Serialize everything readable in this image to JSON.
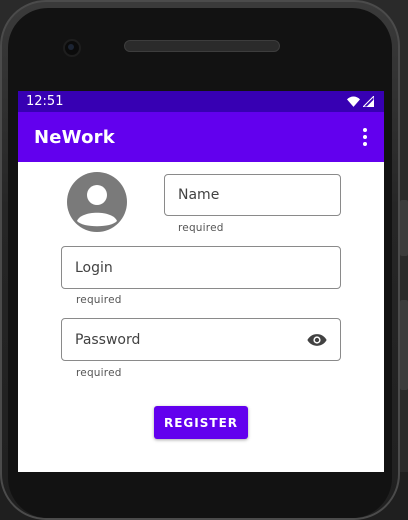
{
  "status_bar": {
    "time": "12:51",
    "wifi_icon": "wifi-icon",
    "signal_icon": "signal-icon"
  },
  "app_bar": {
    "title": "NeWork",
    "menu_icon": "more-vert-icon"
  },
  "form": {
    "avatar_icon": "account-circle-icon",
    "name": {
      "placeholder": "Name",
      "helper": "required"
    },
    "login": {
      "placeholder": "Login",
      "helper": "required"
    },
    "password": {
      "placeholder": "Password",
      "helper": "required",
      "toggle_icon": "eye-icon"
    },
    "register_label": "REGISTER"
  },
  "colors": {
    "primary": "#6200EE",
    "primary_dark": "#3700B3"
  }
}
